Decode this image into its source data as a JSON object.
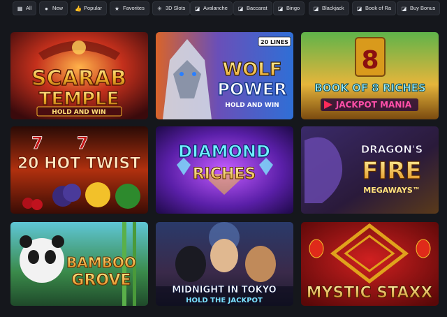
{
  "filters": [
    {
      "label": "All",
      "icon": "grid-icon"
    },
    {
      "label": "New",
      "icon": "dot-icon"
    },
    {
      "label": "Popular",
      "icon": "thumbs-up-icon"
    },
    {
      "label": "Favorites",
      "icon": "star-icon"
    },
    {
      "label": "3D Slots",
      "icon": "spark-icon"
    },
    {
      "label": "Avalanche",
      "icon": "slot-icon"
    },
    {
      "label": "Baccarat",
      "icon": "slot-icon"
    },
    {
      "label": "Bingo",
      "icon": "slot-icon"
    },
    {
      "label": "Blackjack",
      "icon": "slot-icon"
    },
    {
      "label": "Book of Ra",
      "icon": "slot-icon"
    },
    {
      "label": "Buy Bonus",
      "icon": "slot-icon"
    }
  ],
  "games": [
    {
      "title_lines": [
        "SCARAB",
        "TEMPLE"
      ],
      "subtitle": "HOLD AND WIN",
      "badge": ""
    },
    {
      "title_lines": [
        "WOLF",
        "POWER"
      ],
      "subtitle": "HOLD AND WIN",
      "badge": "20 LINES"
    },
    {
      "title_lines": [
        "BOOK OF 8 RICHES"
      ],
      "subtitle": "JACKPOT MANIA",
      "badge": ""
    },
    {
      "title_lines": [
        "20 HOT TWIST"
      ],
      "subtitle": "",
      "badge": ""
    },
    {
      "title_lines": [
        "DIAMOND",
        "RICHES"
      ],
      "subtitle": "",
      "badge": ""
    },
    {
      "title_lines": [
        "DRAGON'S",
        "FIRE"
      ],
      "subtitle": "MEGAWAYS™",
      "badge": ""
    },
    {
      "title_lines": [
        "BAMBOO",
        "GROVE"
      ],
      "subtitle": "",
      "badge": ""
    },
    {
      "title_lines": [
        "MIDNIGHT IN TOKYO"
      ],
      "subtitle": "HOLD THE JACKPOT",
      "badge": ""
    },
    {
      "title_lines": [
        "MYSTIC STAXX"
      ],
      "subtitle": "",
      "badge": ""
    }
  ],
  "colors": {
    "background": "#15171c",
    "chip": "#23262d",
    "chip_text": "#e6e8ec"
  }
}
